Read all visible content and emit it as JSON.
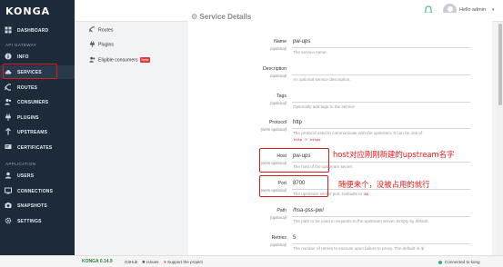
{
  "app": {
    "brand": "KONGA"
  },
  "header": {
    "user_label": "Hello admin",
    "caret": "▾"
  },
  "sidebar": {
    "items_top": [
      {
        "label": "DASHBOARD",
        "icon": "dashboard-icon"
      }
    ],
    "section_api": "API GATEWAY",
    "items_api": [
      {
        "label": "INFO",
        "icon": "info-icon"
      },
      {
        "label": "SERVICES",
        "icon": "cloud-icon"
      },
      {
        "label": "ROUTES",
        "icon": "routes-icon"
      },
      {
        "label": "CONSUMERS",
        "icon": "users-icon"
      },
      {
        "label": "PLUGINS",
        "icon": "plug-icon"
      },
      {
        "label": "UPSTREAMS",
        "icon": "upstreams-icon"
      },
      {
        "label": "CERTIFICATES",
        "icon": "certificate-icon"
      }
    ],
    "section_app": "APPLICATION",
    "items_app": [
      {
        "label": "USERS",
        "icon": "user-icon"
      },
      {
        "label": "CONNECTIONS",
        "icon": "connections-icon"
      },
      {
        "label": "SNAPSHOTS",
        "icon": "camera-icon"
      },
      {
        "label": "SETTINGS",
        "icon": "gear-icon"
      }
    ]
  },
  "subnav": {
    "routes": "Routes",
    "plugins": "Plugins",
    "eligible": "Eligible consumers",
    "beta": "beta"
  },
  "card": {
    "title": "Service Details"
  },
  "fields": [
    {
      "label": "Name",
      "opt": "(optional)",
      "value": "pw-ups",
      "help": "The service name."
    },
    {
      "label": "Description",
      "opt": "(optional)",
      "value": "",
      "help": "An optional service description."
    },
    {
      "label": "Tags",
      "opt": "(optional)",
      "value": "",
      "help": "Optionally add tags to the service"
    },
    {
      "label": "Protocol",
      "opt": "(semi-optional)",
      "value": "http",
      "help": "The protocol used to communicate with the upstream. It can be one of",
      "help_code1": "http",
      "help_or": "or",
      "help_code2": "https"
    },
    {
      "label": "Host",
      "opt": "(semi-optional)",
      "value": "pw-ups",
      "help": "The host of the upstream server."
    },
    {
      "label": "Port",
      "opt": "(semi-optional)",
      "value": "8700",
      "help": "The upstream server port. Defaults to",
      "help_code1": "80"
    },
    {
      "label": "Path",
      "opt": "(optional)",
      "value": "/hsa-pss-pw/",
      "help": "The path to be used in requests to the upstream server. Empty by default."
    },
    {
      "label": "Retries",
      "opt": "(optional)",
      "value": "5",
      "help": "The number of retries to execute upon failure to proxy. The default is",
      "help_code1": "5"
    }
  ],
  "annotations": {
    "host_note": "host对应刚刚新建的upstream名字",
    "port_note": "随便来个，没被占用的就行"
  },
  "footer": {
    "brand": "KONGA 0.14.9",
    "github": "GitHub",
    "issues": "Issues",
    "support": "Support the project",
    "status": "Connected to kong"
  },
  "colors": {
    "sidebar_bg": "#1c2a3a",
    "annotation_red": "#e0191b",
    "brand_green": "#2d7d3a",
    "card_bg": "#ffffff"
  }
}
